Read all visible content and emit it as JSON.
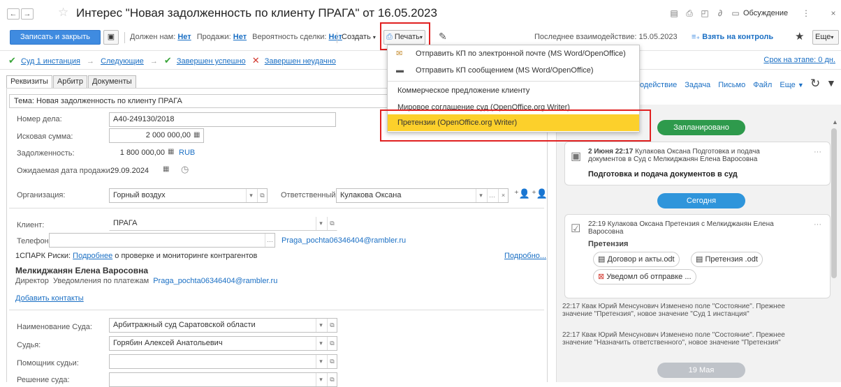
{
  "window": {
    "title": "Интерес \"Новая задолженность по клиенту ПРАГА\" от 16.05.2023",
    "discussion_label": "Обсуждение"
  },
  "toolbar": {
    "save_close_label": "Записать и закрыть",
    "owes_label": "Должен нам:",
    "owes_value": "Нет",
    "sales_label": "Продажи:",
    "sales_value": "Нет",
    "probability_label": "Вероятность сделки:",
    "probability_value": "Нет",
    "create_label": "Создать",
    "print_label": "Печать",
    "last_interaction": "Последнее взаимодействие: 15.05.2023",
    "take_control_label": "Взять на контроль",
    "more_label": "Еще"
  },
  "status": {
    "stage1": "Суд 1 инстанция",
    "next": "Следующие",
    "success": "Завершен успешно",
    "fail": "Завершен неудачно",
    "deadline": "Срок на этапе: 0 дн."
  },
  "tabs": [
    "Реквизиты",
    "Арбитр",
    "Документы"
  ],
  "form": {
    "topic": "Тема: Новая задолженность по клиенту ПРАГА",
    "case_label": "Номер дела:",
    "case_value": "А40-249130/2018",
    "claim_label": "Исковая сумма:",
    "claim_value": "2 000 000,00",
    "debt_label": "Задолженность:",
    "debt_value": "1 800 000,00",
    "debt_currency": "RUB",
    "sale_date_label": "Ожидаемая дата продажи:",
    "sale_date_value": "29.09.2024",
    "org_label": "Организация:",
    "org_value": "Горный воздух",
    "resp_label": "Ответственный:",
    "resp_value": "Кулакова Оксана",
    "client_label": "Клиент:",
    "client_value": "ПРАГА",
    "phone_label": "Телефон:",
    "phone_value": "",
    "client_email": "Praga_pochta06346404@rambler.ru",
    "spark_prefix": "1СПАРК Риски:",
    "spark_link": "Подробнее",
    "spark_suffix": "о проверке и мониторинге контрагентов",
    "details_link": "Подробно...",
    "contact_name": "Мелкиджанян Елена Варосовна",
    "contact_role": "Директор",
    "contact_notify": "Уведомления по платежам",
    "contact_email": "Praga_pochta06346404@rambler.ru",
    "add_contacts": "Добавить контакты",
    "court_label": "Наименование Суда:",
    "court_value": "Арбитражный суд Саратовской области",
    "judge_label": "Судья:",
    "judge_value": "Горябин Алексей Анатольевич",
    "assistant_label": "Помощник судьи:",
    "assistant_value": "",
    "decision_label": "Решение суда:",
    "decision_value": ""
  },
  "right": {
    "links": [
      "одействие",
      "Задача",
      "Письмо",
      "Файл",
      "Еще"
    ],
    "planned": "Запланировано",
    "card1_date": "2 Июня 22:17",
    "card1_text": "Кулакова Оксана Подготовка и подача документов в Суд с Мелкиджанян Елена Варосовна",
    "card1_title": "Подготовка и подача документов в суд",
    "today": "Сегодня",
    "card2_text": "22:19 Кулакова Оксана Претензия с Мелкиджанян Елена Варосовна",
    "card2_title": "Претензия",
    "file1": "Договор и акты.odt",
    "file2": "Претензия .odt",
    "file3": "Уведомл об отправке ...",
    "log1": "22:17 Квак Юрий Менсунович Изменено поле \"Состояние\". Прежнее значение \"Претензия\", новое значение \"Суд 1 инстанция\"",
    "log2": "22:17 Квак Юрий Менсунович Изменено поле \"Состояние\". Прежнее значение \"Назначить ответственного\", новое значение \"Претензия\"",
    "may19": "19 Мая"
  },
  "print_menu": {
    "items": [
      "Отправить КП по электронной почте (MS Word/OpenOffice)",
      "Отправить КП сообщением (MS Word/OpenOffice)",
      "Коммерческое предложение клиенту",
      "Мировое соглашение суд (OpenOffice.org Writer)",
      "Претензии (OpenOffice.org Writer)"
    ]
  },
  "colors": {
    "primary": "#3f8be0",
    "link": "#1a6fc4",
    "highlight": "#fcd02b",
    "planned_green": "#2e9a4c",
    "today_blue": "#2f95db",
    "annotation_red": "#e02020"
  }
}
